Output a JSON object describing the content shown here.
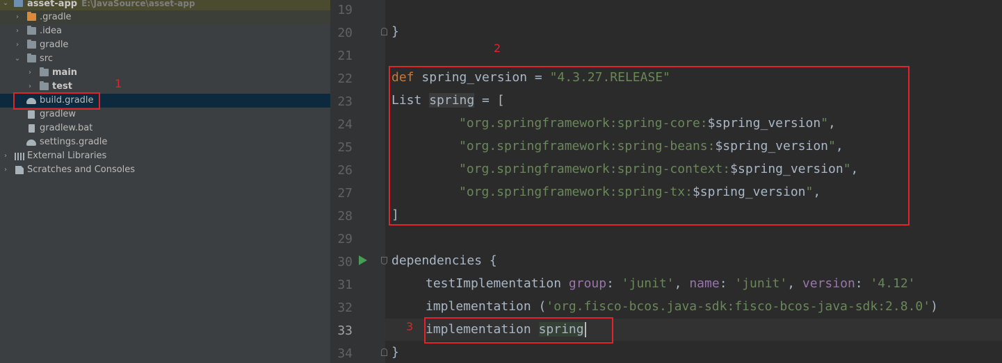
{
  "project_tree": {
    "root": {
      "name": "asset-app",
      "path": "E:\\JavaSource\\asset-app"
    },
    "items": [
      {
        "label": ".gradle"
      },
      {
        "label": ".idea"
      },
      {
        "label": "gradle"
      },
      {
        "label": "src"
      },
      {
        "label": "main"
      },
      {
        "label": "test"
      },
      {
        "label": "build.gradle"
      },
      {
        "label": "gradlew"
      },
      {
        "label": "gradlew.bat"
      },
      {
        "label": "settings.gradle"
      },
      {
        "label": "External Libraries"
      },
      {
        "label": "Scratches and Consoles"
      }
    ]
  },
  "annotations": {
    "one": "1",
    "two": "2",
    "three": "3"
  },
  "editor": {
    "line_numbers": [
      "19",
      "20",
      "21",
      "22",
      "23",
      "24",
      "25",
      "26",
      "27",
      "28",
      "29",
      "30",
      "31",
      "32",
      "33",
      "34"
    ],
    "code": {
      "l20": "}",
      "l22_kw": "def",
      "l22_a": " spring_version = ",
      "l22_str": "\"4.3.27.RELEASE\"",
      "l23_a": "List ",
      "l23_var": "spring",
      "l23_b": " = [",
      "l24_str": "\"org.springframework:spring-core:",
      "l24_tmpl": "$spring_version",
      "l24_end": "\"",
      "l24_comma": ",",
      "l25_str": "\"org.springframework:spring-beans:",
      "l25_tmpl": "$spring_version",
      "l25_end": "\"",
      "l25_comma": ",",
      "l26_str": "\"org.springframework:spring-context:",
      "l26_tmpl": "$spring_version",
      "l26_end": "\"",
      "l26_comma": ",",
      "l27_str": "\"org.springframework:spring-tx:",
      "l27_tmpl": "$spring_version",
      "l27_end": "\"",
      "l27_comma": ",",
      "l28": "]",
      "l30": "dependencies {",
      "l31_a": "testImplementation ",
      "l31_k1": "group",
      "l31_b": ": ",
      "l31_v1": "'junit'",
      "l31_c": ", ",
      "l31_k2": "name",
      "l31_d": ": ",
      "l31_v2": "'junit'",
      "l31_e": ", ",
      "l31_k3": "version",
      "l31_f": ": ",
      "l31_v3": "'4.12'",
      "l32_a": "implementation (",
      "l32_str": "'org.fisco-bcos.java-sdk:fisco-bcos-java-sdk:2.8.0'",
      "l32_b": ")",
      "l33_a": "implementation ",
      "l33_var": "spring",
      "l34": "}"
    }
  },
  "colors": {
    "keyword": "#cc7832",
    "string": "#6a8759",
    "named_arg": "#9876aa",
    "annotation_red": "#e0242b",
    "run_green": "#499c54"
  }
}
